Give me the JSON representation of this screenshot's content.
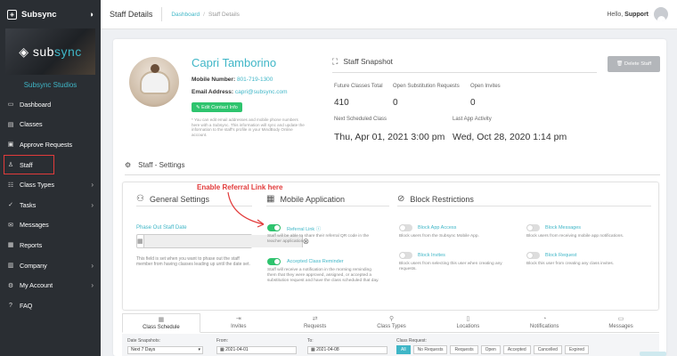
{
  "app": {
    "brand": "Subsync",
    "studio": "Subsync Studios",
    "hero_text_a": "sub",
    "hero_text_b": "sync"
  },
  "nav": [
    {
      "label": "Dashboard",
      "icon": "dashboard-icon",
      "glyph": "▭",
      "chevron": false
    },
    {
      "label": "Classes",
      "icon": "classes-icon",
      "glyph": "▤",
      "chevron": false
    },
    {
      "label": "Approve Requests",
      "icon": "approve-icon",
      "glyph": "▣",
      "chevron": false
    },
    {
      "label": "Staff",
      "icon": "staff-icon",
      "glyph": "♙",
      "chevron": false,
      "active": true
    },
    {
      "label": "Class Types",
      "icon": "class-types-icon",
      "glyph": "☷",
      "chevron": true
    },
    {
      "label": "Tasks",
      "icon": "tasks-icon",
      "glyph": "✓",
      "chevron": true
    },
    {
      "label": "Messages",
      "icon": "messages-icon",
      "glyph": "✉",
      "chevron": false
    },
    {
      "label": "Reports",
      "icon": "reports-icon",
      "glyph": "▦",
      "chevron": false
    },
    {
      "label": "Company",
      "icon": "company-icon",
      "glyph": "▥",
      "chevron": true
    },
    {
      "label": "My Account",
      "icon": "account-icon",
      "glyph": "⚙",
      "chevron": true
    },
    {
      "label": "FAQ",
      "icon": "faq-icon",
      "glyph": "?",
      "chevron": false
    }
  ],
  "topbar": {
    "title": "Staff Details",
    "crumb_home": "Dashboard",
    "crumb_sep": "/",
    "crumb_current": "Staff Details",
    "hello": "Hello,",
    "user": "Support"
  },
  "profile": {
    "name": "Capri Tamborino",
    "mobile_label": "Mobile Number:",
    "mobile": "801-719-1300",
    "email_label": "Email Address:",
    "email": "capri@subsync.com",
    "edit_btn": "✎ Edit Contact Info",
    "note": "* You can edit email addresses and mobile phone numbers here with a Subsync. This information will sync and update the information to the staff's profile in your MindBody Online account."
  },
  "snapshot": {
    "title": "Staff Snapshot",
    "delete_btn": "🗑 Delete Staff",
    "future_label": "Future Classes Total",
    "future": "410",
    "open_sub_label": "Open Substitution Requests",
    "open_sub": "0",
    "open_inv_label": "Open Invites",
    "open_inv": "0",
    "next_label": "Next Scheduled Class",
    "next": "Thu, Apr 01, 2021 3:00 pm",
    "last_label": "Last App Activity",
    "last": "Wed, Oct 28, 2020 1:14 pm"
  },
  "settings": {
    "section_title": "Staff - Settings",
    "general": "General Settings",
    "mobile": "Mobile Application",
    "block": "Block Restrictions",
    "phase_label": "Phase Out Staff Date",
    "phase_help": "This field is set when you want to phase out the staff member from having classes leading up until the date set.",
    "referral_label": "Referral Link",
    "referral_desc": "Staff will be able to share their referral QR code in the teacher application.",
    "accepted_label": "Accepted Class Reminder",
    "accepted_desc": "Staff will receive a notification in the morning reminding them that they were approved, assigned, or accepted a substitution request and have the class scheduled that day.",
    "block_app": "Block App Access",
    "block_app_desc": "Block users from the Subsync Mobile App.",
    "block_inv": "Block Invites",
    "block_inv_desc": "Block users from selecting this user when creating any requests.",
    "block_msg": "Block Messages",
    "block_msg_desc": "Block users from receiving mobile app notifications.",
    "block_req": "Block Request",
    "block_req_desc": "Block this user from creating any class invites."
  },
  "annotation": "Enable Referral Link here",
  "tabs": [
    {
      "label": "Class Schedule",
      "icon": "calendar-icon",
      "glyph": "▦",
      "active": true
    },
    {
      "label": "Invites",
      "icon": "invites-icon",
      "glyph": "⇥"
    },
    {
      "label": "Requests",
      "icon": "requests-icon",
      "glyph": "⇄"
    },
    {
      "label": "Class Types",
      "icon": "bike-icon",
      "glyph": "⚲"
    },
    {
      "label": "Locations",
      "icon": "location-icon",
      "glyph": "▯"
    },
    {
      "label": "Notifications",
      "icon": "bell-icon",
      "glyph": "◔"
    },
    {
      "label": "Messages",
      "icon": "messages-icon",
      "glyph": "▭"
    }
  ],
  "filters": {
    "snapshot_label": "Date Snapshots:",
    "snapshot": "Next 7 Days",
    "from_label": "From:",
    "from": "2021-04-01",
    "to_label": "To:",
    "to": "2021-04-08",
    "req_label": "Class Request:",
    "options": [
      "All",
      "No Requests",
      "Requests",
      "Open",
      "Accepted",
      "Cancelled",
      "Expired"
    ]
  }
}
